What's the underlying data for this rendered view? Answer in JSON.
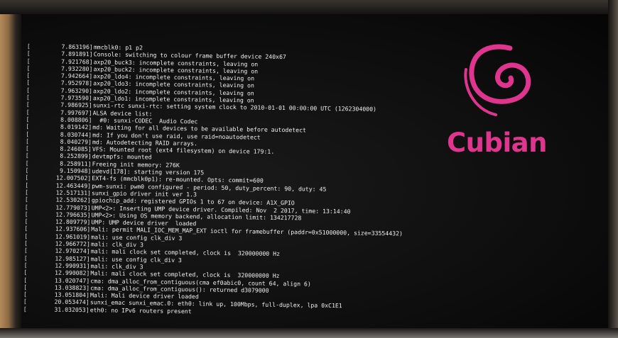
{
  "brand": {
    "name": "Cubian",
    "color": "#e0358f",
    "logo": "debian-swirl-icon"
  },
  "console": {
    "lines": [
      {
        "ts": "7.863196",
        "msg": "mmcblk0: p1 p2"
      },
      {
        "ts": "7.891891",
        "msg": "Console: switching to colour frame buffer device 240x67"
      },
      {
        "ts": "7.921768",
        "msg": "axp20_buck3: incomplete constraints, leaving on"
      },
      {
        "ts": "7.932280",
        "msg": "axp20_buck2: incomplete constraints, leaving on"
      },
      {
        "ts": "7.942664",
        "msg": "axp20_ldo4: incomplete constraints, leaving on"
      },
      {
        "ts": "7.952978",
        "msg": "axp20_ldo3: incomplete constraints, leaving on"
      },
      {
        "ts": "7.963290",
        "msg": "axp20_ldo2: incomplete constraints, leaving on"
      },
      {
        "ts": "7.973590",
        "msg": "axp20_ldo1: incomplete constraints, leaving on"
      },
      {
        "ts": "7.986925",
        "msg": "sunxi-rtc sunxi-rtc: setting system clock to 2010-01-01 00:00:00 UTC (1262304000)"
      },
      {
        "ts": "7.997697",
        "msg": "ALSA device list:"
      },
      {
        "ts": "8.008806",
        "msg": "  #0: sunxi-CODEC  Audio Codec"
      },
      {
        "ts": "8.019142",
        "msg": "md: Waiting for all devices to be available before autodetect"
      },
      {
        "ts": "8.030744",
        "msg": "md: If you don't use raid, use raid=noautodetect"
      },
      {
        "ts": "8.040279",
        "msg": "md: Autodetecting RAID arrays."
      },
      {
        "ts": "8.246085",
        "msg": "VFS: Mounted root (ext4 filesystem) on device 179:1."
      },
      {
        "ts": "8.252899",
        "msg": "devtmpfs: mounted"
      },
      {
        "ts": "8.258911",
        "msg": "Freeing init memory: 276K"
      },
      {
        "ts": "9.150948",
        "msg": "udevd[178]: starting version 175"
      },
      {
        "ts": "12.007502",
        "msg": "EXT4-fs (mmcblk0p1): re-mounted. Opts: commit=600"
      },
      {
        "ts": "12.463449",
        "msg": "pwm-sunxi: pwm0 configured - period: 50, duty_percent: 90, duty: 45"
      },
      {
        "ts": "12.517131",
        "msg": "sunxi_gpio driver init ver 1.3"
      },
      {
        "ts": "12.530262",
        "msg": "gpiochip_add: registered GPIOs 1 to 67 on device: A1X_GPIO"
      },
      {
        "ts": "12.779073",
        "msg": "UMP<2>: Inserting UMP device driver. Compiled: Nov  2 2017, time: 13:14:40"
      },
      {
        "ts": "12.796635",
        "msg": "UMP<2>: Using OS memory backend, allocation limit: 134217728"
      },
      {
        "ts": "12.809779",
        "msg": "UMP: UMP device driver  loaded"
      },
      {
        "ts": "12.937606",
        "msg": "Mali: permit MALI_IOC_MEM_MAP_EXT ioctl for framebuffer (paddr=0x51000000, size=33554432)"
      },
      {
        "ts": "12.961019",
        "msg": "mali: use config clk_div 3"
      },
      {
        "ts": "12.966772",
        "msg": "mali: clk_div 3"
      },
      {
        "ts": "12.970274",
        "msg": "mali: mali clock set completed, clock is  320000000 Hz"
      },
      {
        "ts": "12.985127",
        "msg": "mali: use config clk_div 3"
      },
      {
        "ts": "12.990931",
        "msg": "mali: clk_div 3"
      },
      {
        "ts": "12.990082",
        "msg": "Mali: mali clock set completed, clock is  320000000 Hz"
      },
      {
        "ts": "13.020747",
        "msg": "cma: dma_alloc_from_contiguous(cma ef0abic0, count 64, align 6)"
      },
      {
        "ts": "13.038823",
        "msg": "cma: dma_alloc_from_contiguous(): returned d3079000"
      },
      {
        "ts": "13.051804",
        "msg": "Mali: Mali device driver loaded"
      },
      {
        "ts": "20.053474",
        "msg": "sunxi_emac sunxi_emac.0: eth0: link up, 100Mbps, full-duplex, lpa 0xC1E1"
      },
      {
        "ts": "31.032053",
        "msg": "eth0: no IPv6 routers present"
      }
    ]
  }
}
